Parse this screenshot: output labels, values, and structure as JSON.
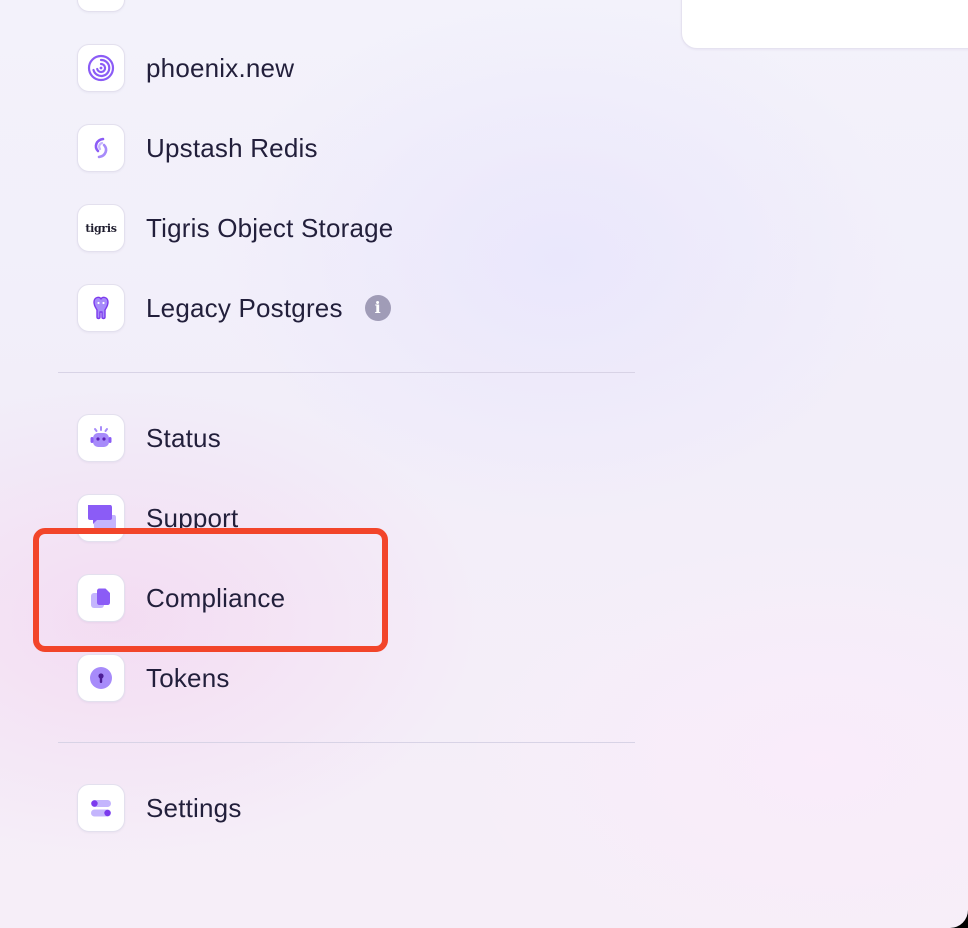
{
  "nav": {
    "items": [
      {
        "label": "phoenix.new",
        "icon": "phoenix-swirl-icon"
      },
      {
        "label": "Upstash Redis",
        "icon": "upstash-icon"
      },
      {
        "label": "Tigris Object Storage",
        "icon": "tigris-logo-icon",
        "logo_text": "tigris"
      },
      {
        "label": "Legacy Postgres",
        "icon": "postgres-elephant-icon",
        "info_icon": "i"
      },
      {
        "label": "Status",
        "icon": "robot-icon"
      },
      {
        "label": "Support",
        "icon": "chat-bubble-icon"
      },
      {
        "label": "Compliance",
        "icon": "documents-icon"
      },
      {
        "label": "Tokens",
        "icon": "keyhole-icon"
      },
      {
        "label": "Settings",
        "icon": "toggle-switches-icon"
      }
    ]
  },
  "colors": {
    "accent": "#8b5cf6",
    "accent_light": "#c4b5fd",
    "text": "#221f3b",
    "highlight": "#f2452a"
  }
}
